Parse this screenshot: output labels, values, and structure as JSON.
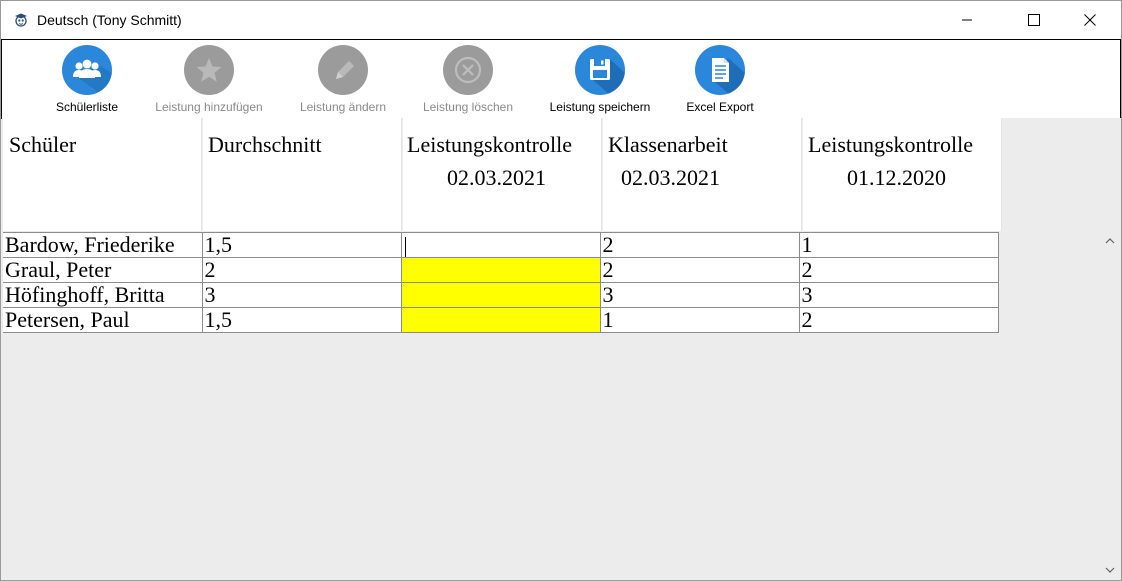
{
  "window": {
    "title": "Deutsch (Tony Schmitt)"
  },
  "toolbar": {
    "buttons": [
      {
        "label": "Schülerliste",
        "icon": "users-icon",
        "enabled": true
      },
      {
        "label": "Leistung hinzufügen",
        "icon": "star-icon",
        "enabled": false
      },
      {
        "label": "Leistung ändern",
        "icon": "pencil-icon",
        "enabled": false
      },
      {
        "label": "Leistung löschen",
        "icon": "delete-circle-icon",
        "enabled": false
      },
      {
        "label": "Leistung speichern",
        "icon": "floppy-disk-icon",
        "enabled": true
      },
      {
        "label": "Excel Export",
        "icon": "document-icon",
        "enabled": true
      }
    ]
  },
  "grid": {
    "columns": [
      {
        "line1": "Schüler",
        "line2": ""
      },
      {
        "line1": "Durchschnitt",
        "line2": ""
      },
      {
        "line1": "Leistungskontrolle",
        "line2": "02.03.2021"
      },
      {
        "line1": "Klassenarbeit",
        "line2": "02.03.2021"
      },
      {
        "line1": "Leistungskontrolle",
        "line2": "01.12.2020"
      }
    ],
    "rows": [
      {
        "name": "Bardow, Friederike",
        "avg": "1,5",
        "c1": "",
        "c2": "2",
        "c3": "1"
      },
      {
        "name": "Graul, Peter",
        "avg": "2",
        "c1": "",
        "c2": "2",
        "c3": "2"
      },
      {
        "name": "Höfinghoff, Britta",
        "avg": "3",
        "c1": "",
        "c2": "3",
        "c3": "3"
      },
      {
        "name": "Petersen, Paul",
        "avg": "1,5",
        "c1": "",
        "c2": "1",
        "c3": "2"
      }
    ]
  },
  "colors": {
    "accent": "#2b87d9",
    "disabled": "#9b9b9b",
    "highlight": "#ffff00"
  }
}
